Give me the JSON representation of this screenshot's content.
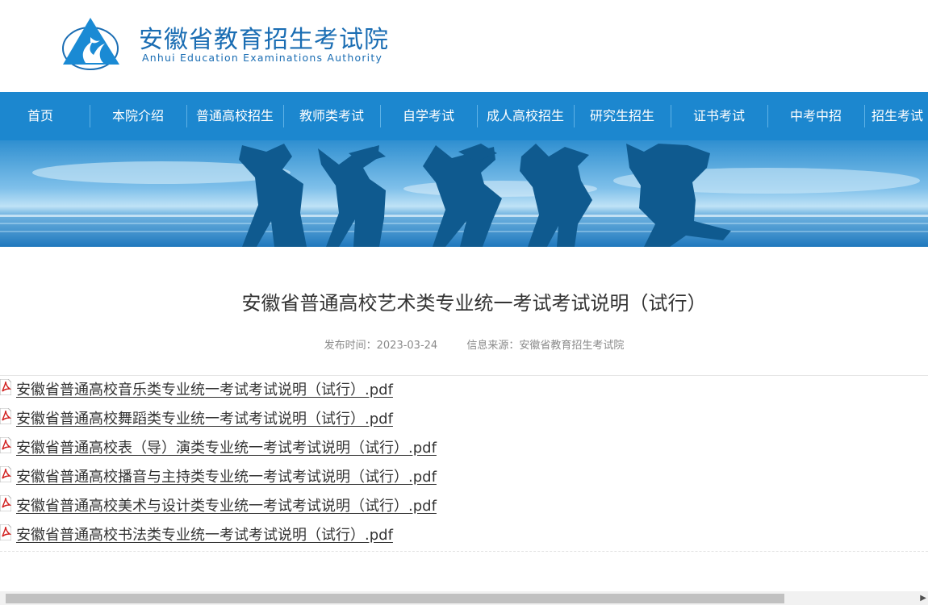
{
  "site": {
    "name_cn": "安徽省教育招生考试院",
    "name_en": "Anhui Education Examinations Authority",
    "brand_color": "#1a6db3",
    "logo_icon": "flame-triangle-logo-icon"
  },
  "nav": {
    "background": "#1c87cf",
    "items": [
      {
        "label": "首页"
      },
      {
        "label": "本院介绍"
      },
      {
        "label": "普通高校招生"
      },
      {
        "label": "教师类考试"
      },
      {
        "label": "自学考试"
      },
      {
        "label": "成人高校招生"
      },
      {
        "label": "研究生招生"
      },
      {
        "label": "证书考试"
      },
      {
        "label": "中考中招"
      },
      {
        "label": "招生考试"
      }
    ]
  },
  "banner": {
    "icon": "graduates-silhouette-banner"
  },
  "article": {
    "title": "安徽省普通高校艺术类专业统一考试考试说明（试行）",
    "publish_time": "发布时间：2023-03-24",
    "source": "信息来源：安徽省教育招生考试院",
    "attachments": [
      {
        "label": "安徽省普通高校音乐类专业统一考试考试说明（试行）.pdf",
        "icon": "pdf-icon"
      },
      {
        "label": "安徽省普通高校舞蹈类专业统一考试考试说明（试行）.pdf",
        "icon": "pdf-icon"
      },
      {
        "label": "安徽省普通高校表（导）演类专业统一考试考试说明（试行）.pdf",
        "icon": "pdf-icon"
      },
      {
        "label": "安徽省普通高校播音与主持类专业统一考试考试说明（试行）.pdf",
        "icon": "pdf-icon"
      },
      {
        "label": "安徽省普通高校美术与设计类专业统一考试考试说明（试行）.pdf",
        "icon": "pdf-icon"
      },
      {
        "label": "安徽省普通高校书法类专业统一考试考试说明（试行）.pdf",
        "icon": "pdf-icon"
      }
    ]
  },
  "scrollbar": {
    "icon": "horizontal-scrollbar"
  }
}
